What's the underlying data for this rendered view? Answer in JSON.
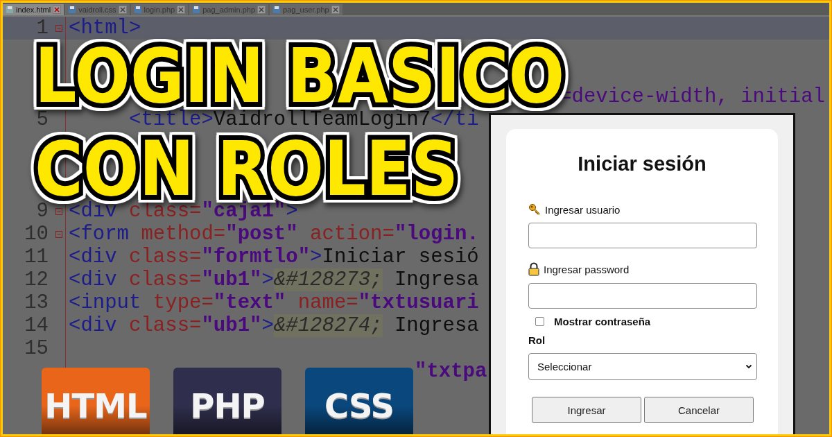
{
  "tabs": [
    {
      "label": "index.html",
      "selected": true
    },
    {
      "label": "vaidroll.css",
      "selected": false
    },
    {
      "label": "login.php",
      "selected": false
    },
    {
      "label": "pag_admin.php",
      "selected": false
    },
    {
      "label": "pag_user.php",
      "selected": false
    }
  ],
  "code_lines": [
    {
      "kind": "code",
      "number": "1",
      "fold": true,
      "current": true,
      "tokens": [
        {
          "kind": "tag",
          "text": "<html>"
        }
      ]
    },
    {
      "kind": "covered"
    },
    {
      "kind": "covered"
    },
    {
      "kind": "covered",
      "tail": {
        "kind": "value",
        "text": "=device-width, initial"
      }
    },
    {
      "kind": "code",
      "number": "5",
      "fold": false,
      "current": false,
      "tokens": [
        {
          "kind": "tag",
          "text": "     <title>"
        },
        {
          "kind": "text",
          "text": "VaidrollTeamLogin7"
        },
        {
          "kind": "tag",
          "text": "</ti"
        }
      ]
    },
    {
      "kind": "covered"
    },
    {
      "kind": "covered"
    },
    {
      "kind": "covered"
    },
    {
      "kind": "code",
      "number": "9",
      "fold": true,
      "current": false,
      "tokens": [
        {
          "kind": "tag",
          "text": "<div"
        },
        {
          "kind": "attr",
          "text": " class="
        },
        {
          "kind": "value",
          "text": "\"caja1\""
        },
        {
          "kind": "tag",
          "text": ">"
        }
      ]
    },
    {
      "kind": "code",
      "number": "10",
      "fold": true,
      "current": false,
      "tokens": [
        {
          "kind": "tag",
          "text": "<form"
        },
        {
          "kind": "attr",
          "text": " method="
        },
        {
          "kind": "value",
          "text": "\"post\""
        },
        {
          "kind": "attr",
          "text": " action="
        },
        {
          "kind": "value",
          "text": "\"login."
        }
      ]
    },
    {
      "kind": "code",
      "number": "11",
      "fold": false,
      "current": false,
      "tokens": [
        {
          "kind": "tag",
          "text": "<div"
        },
        {
          "kind": "attr",
          "text": " class="
        },
        {
          "kind": "value",
          "text": "\"formtlo\""
        },
        {
          "kind": "tag",
          "text": ">"
        },
        {
          "kind": "text",
          "text": "Iniciar sesió"
        }
      ]
    },
    {
      "kind": "code",
      "number": "12",
      "fold": false,
      "current": false,
      "tokens": [
        {
          "kind": "tag",
          "text": "<div"
        },
        {
          "kind": "attr",
          "text": " class="
        },
        {
          "kind": "value",
          "text": "\"ub1\""
        },
        {
          "kind": "tag",
          "text": ">"
        },
        {
          "kind": "entity",
          "text": "&#128273;"
        },
        {
          "kind": "text",
          "text": " Ingresa"
        }
      ]
    },
    {
      "kind": "code",
      "number": "13",
      "fold": false,
      "current": false,
      "tokens": [
        {
          "kind": "tag",
          "text": "<input"
        },
        {
          "kind": "attr",
          "text": " type="
        },
        {
          "kind": "value",
          "text": "\"text\""
        },
        {
          "kind": "attr",
          "text": " name="
        },
        {
          "kind": "value",
          "text": "\"txtusuari"
        }
      ]
    },
    {
      "kind": "code",
      "number": "14",
      "fold": false,
      "current": false,
      "tokens": [
        {
          "kind": "tag",
          "text": "<div"
        },
        {
          "kind": "attr",
          "text": " class="
        },
        {
          "kind": "value",
          "text": "\"ub1\""
        },
        {
          "kind": "tag",
          "text": ">"
        },
        {
          "kind": "entity",
          "text": "&#128274;"
        },
        {
          "kind": "text",
          "text": " Ingresa"
        }
      ]
    },
    {
      "kind": "code",
      "number": "15",
      "fold": false,
      "current": false
    },
    {
      "kind": "covered",
      "tail": {
        "kind": "value",
        "text": "\"txtpa"
      }
    },
    {
      "kind": "covered"
    },
    {
      "kind": "covered"
    }
  ],
  "headline": [
    "LOGIN BASICO",
    "CON ROLES"
  ],
  "login": {
    "title": "Iniciar sesión",
    "user_label": "Ingresar usuario",
    "password_label": "Ingresar password",
    "show_password": {
      "label": "Mostrar contraseña",
      "checked": false
    },
    "role_label": "Rol",
    "role_select": "Seleccionar",
    "buttons": [
      "Ingresar",
      "Cancelar"
    ]
  },
  "logos": [
    {
      "text": "HTML",
      "color": "#e8651a"
    },
    {
      "text": "PHP",
      "color": "#2f2e4c"
    },
    {
      "text": "CSS",
      "color": "#0a477c"
    }
  ]
}
